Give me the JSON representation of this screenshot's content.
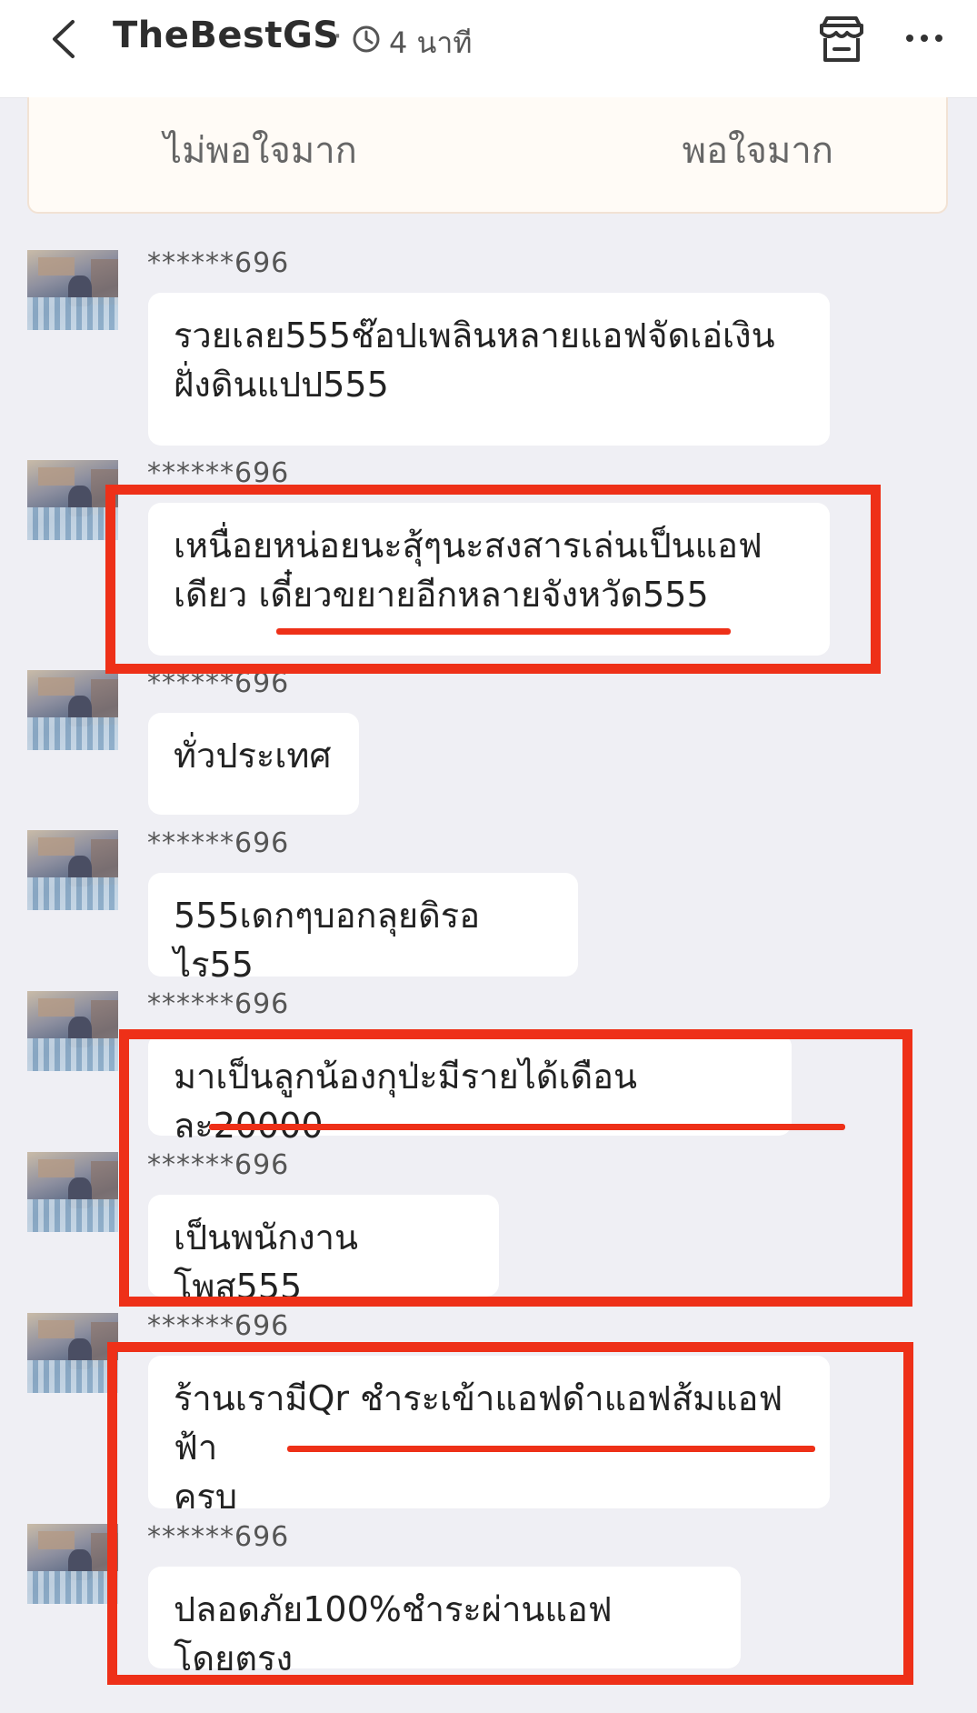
{
  "header": {
    "title": "TheBestGS",
    "separator": "·",
    "time_ago": "4 นาที",
    "icons": [
      "back-arrow-icon",
      "clock-icon",
      "store-icon",
      "more-dots-icon"
    ]
  },
  "rating": {
    "low_label": "ไม่พอใจมาก",
    "high_label": "พอใจมาก"
  },
  "messages": [
    {
      "user": "******696",
      "text": "รวยเลย555ช๊อปเพลินหลายแอฟจัดเอ่เงิน\nฝั่งดินแปป555"
    },
    {
      "user": "******696",
      "text": "เหนื่อยหน่อยนะสุ้ๆนะสงสารเล่นเป็นแอฟ\nเดียว เดี๋ยวขยายอีกหลายจังหวัด555"
    },
    {
      "user": "******696",
      "text": "ทั่วประเทศ"
    },
    {
      "user": "******696",
      "text": "555เดกๆบอกลุยดิรอไร55"
    },
    {
      "user": "******696",
      "text": "มาเป็นลูกน้องกุป่ะมีรายได้เดือนละ20000"
    },
    {
      "user": "******696",
      "text": "เป็นพนักงานโพส555"
    },
    {
      "user": "******696",
      "text": "ร้านเรามีQr ชำระเข้าแอฟดำแอฟส้มแอฟฟ้า\nครบ"
    },
    {
      "user": "******696",
      "text": "ปลอดภัย100%ชำระผ่านแอฟโดยตรง"
    }
  ],
  "colors": {
    "annotation_red": "#ee3018",
    "background": "#efeff4",
    "bubble": "#ffffff"
  }
}
